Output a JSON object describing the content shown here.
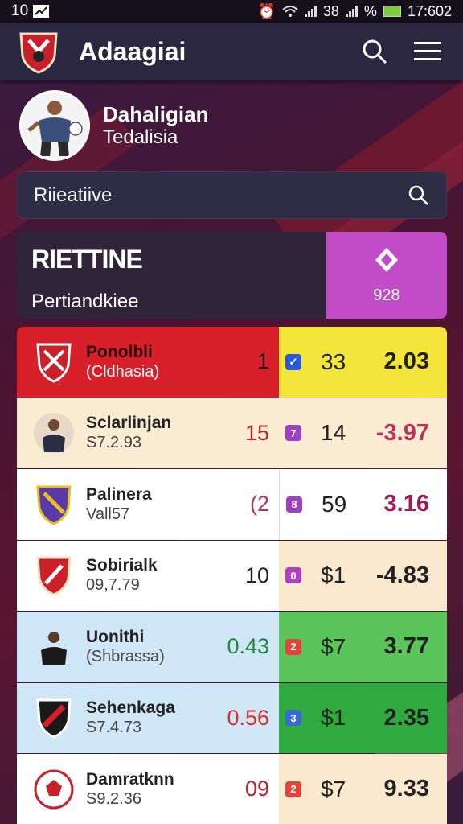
{
  "status": {
    "time_left": "10",
    "battery_text": "38",
    "percent": "%",
    "clock": "17:602"
  },
  "app": {
    "title": "Adaagiai"
  },
  "profile": {
    "name": "Dahaligian",
    "subtitle": "Tedalisia"
  },
  "search": {
    "placeholder": "Riieatiive"
  },
  "realtime": {
    "title": "RIETTINE",
    "subtitle": "Pertiandkiee",
    "value": "928"
  },
  "colors": {
    "accent_magenta": "#c24bc8",
    "header_bg": "#2b2740",
    "red_row": "#d8202a",
    "yellow_cell": "#f4e53a",
    "green_cell": "#5bc55b",
    "blue_row": "#cfe6f6"
  },
  "rows": [
    {
      "name": "Ponolbli",
      "sub": "(Cldhasia)",
      "rank": "1",
      "chk": "✓",
      "num": "33",
      "value": "2.03"
    },
    {
      "name": "Sclarlinjan",
      "sub": "S7.2.93",
      "rank": "15",
      "chk": "7",
      "num": "14",
      "value": "-3.97"
    },
    {
      "name": "Palinera",
      "sub": "Vall57",
      "rank": "(2",
      "chk": "8",
      "num": "59",
      "value": "3.16"
    },
    {
      "name": "Sobirialk",
      "sub": "09,7.79",
      "rank": "10",
      "chk": "0",
      "num": "$1",
      "value": "-4.83"
    },
    {
      "name": "Uonithi",
      "sub": "(Shbrassa)",
      "rank": "0.43",
      "chk": "2",
      "num": "$7",
      "value": "3.77"
    },
    {
      "name": "Sehenkaga",
      "sub": "S7.4.73",
      "rank": "0.56",
      "chk": "3",
      "num": "$1",
      "value": "2.35"
    },
    {
      "name": "Damratknn",
      "sub": "S9.2.36",
      "rank": "09",
      "chk": "2",
      "num": "$7",
      "value": "9.33"
    }
  ]
}
